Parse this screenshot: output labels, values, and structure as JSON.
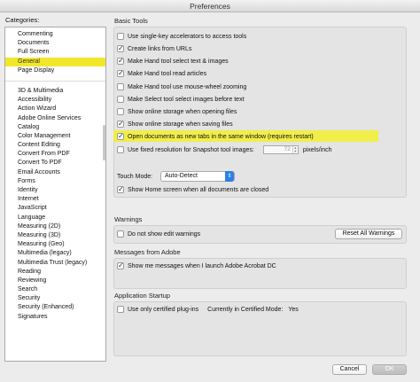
{
  "window": {
    "title": "Preferences"
  },
  "categories": {
    "header": "Categories:",
    "top": [
      "Commenting",
      "Documents",
      "Full Screen",
      "General",
      "Page Display"
    ],
    "selected": "General",
    "rest": [
      "3D & Multimedia",
      "Accessibility",
      "Action Wizard",
      "Adobe Online Services",
      "Catalog",
      "Color Management",
      "Content Editing",
      "Convert From PDF",
      "Convert To PDF",
      "Email Accounts",
      "Forms",
      "Identity",
      "Internet",
      "JavaScript",
      "Language",
      "Measuring (2D)",
      "Measuring (3D)",
      "Measuring (Geo)",
      "Multimedia (legacy)",
      "Multimedia Trust (legacy)",
      "Reading",
      "Reviewing",
      "Search",
      "Security",
      "Security (Enhanced)",
      "Signatures"
    ]
  },
  "basic_tools": {
    "title": "Basic Tools",
    "options": [
      {
        "label": "Use single-key accelerators to access tools",
        "checked": false
      },
      {
        "label": "Create links from URLs",
        "checked": true
      },
      {
        "label": "Make Hand tool select text & images",
        "checked": true
      },
      {
        "label": "Make Hand tool read articles",
        "checked": true
      },
      {
        "label": "Make Hand tool use mouse-wheel zooming",
        "checked": false
      },
      {
        "label": "Make Select tool select images before text",
        "checked": false
      },
      {
        "label": "Show online storage when opening files",
        "checked": false
      },
      {
        "label": "Show online storage when saving files",
        "checked": true
      },
      {
        "label": "Open documents as new tabs in the same window (requires restart)",
        "checked": true
      }
    ],
    "snapshot": {
      "label": "Use fixed resolution for Snapshot tool images:",
      "checked": false,
      "value": "72",
      "unit": "pixels/inch"
    },
    "touch_mode": {
      "label": "Touch Mode:",
      "value": "Auto-Detect"
    },
    "home_screen": {
      "label": "Show Home screen when all documents are closed",
      "checked": true
    }
  },
  "warnings": {
    "title": "Warnings",
    "option": {
      "label": "Do not show edit warnings",
      "checked": false
    },
    "reset_button": "Reset All Warnings"
  },
  "messages": {
    "title": "Messages from Adobe",
    "option": {
      "label": "Show me messages when I launch Adobe Acrobat DC",
      "checked": true
    }
  },
  "startup": {
    "title": "Application Startup",
    "option": {
      "label": "Use only certified plug-ins",
      "checked": false
    },
    "certified_label": "Currently in Certified Mode:",
    "certified_value": "Yes"
  },
  "footer": {
    "cancel": "Cancel",
    "ok": "OK"
  }
}
